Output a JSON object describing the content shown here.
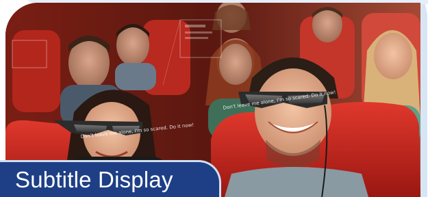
{
  "caption": {
    "title": "Subtitle Display"
  },
  "photo": {
    "scene": "cinema-audience-with-smart-glasses",
    "overlay_subtitle_right": "Don't leave me alone, I'm so scared. Do it now!",
    "overlay_subtitle_left": "Don't leave me alone, I'm so scared. Do it now!"
  },
  "colors": {
    "band": "#1e3f86",
    "seat_red": "#c8261f",
    "border_light_blue": "#cfe0f2"
  }
}
